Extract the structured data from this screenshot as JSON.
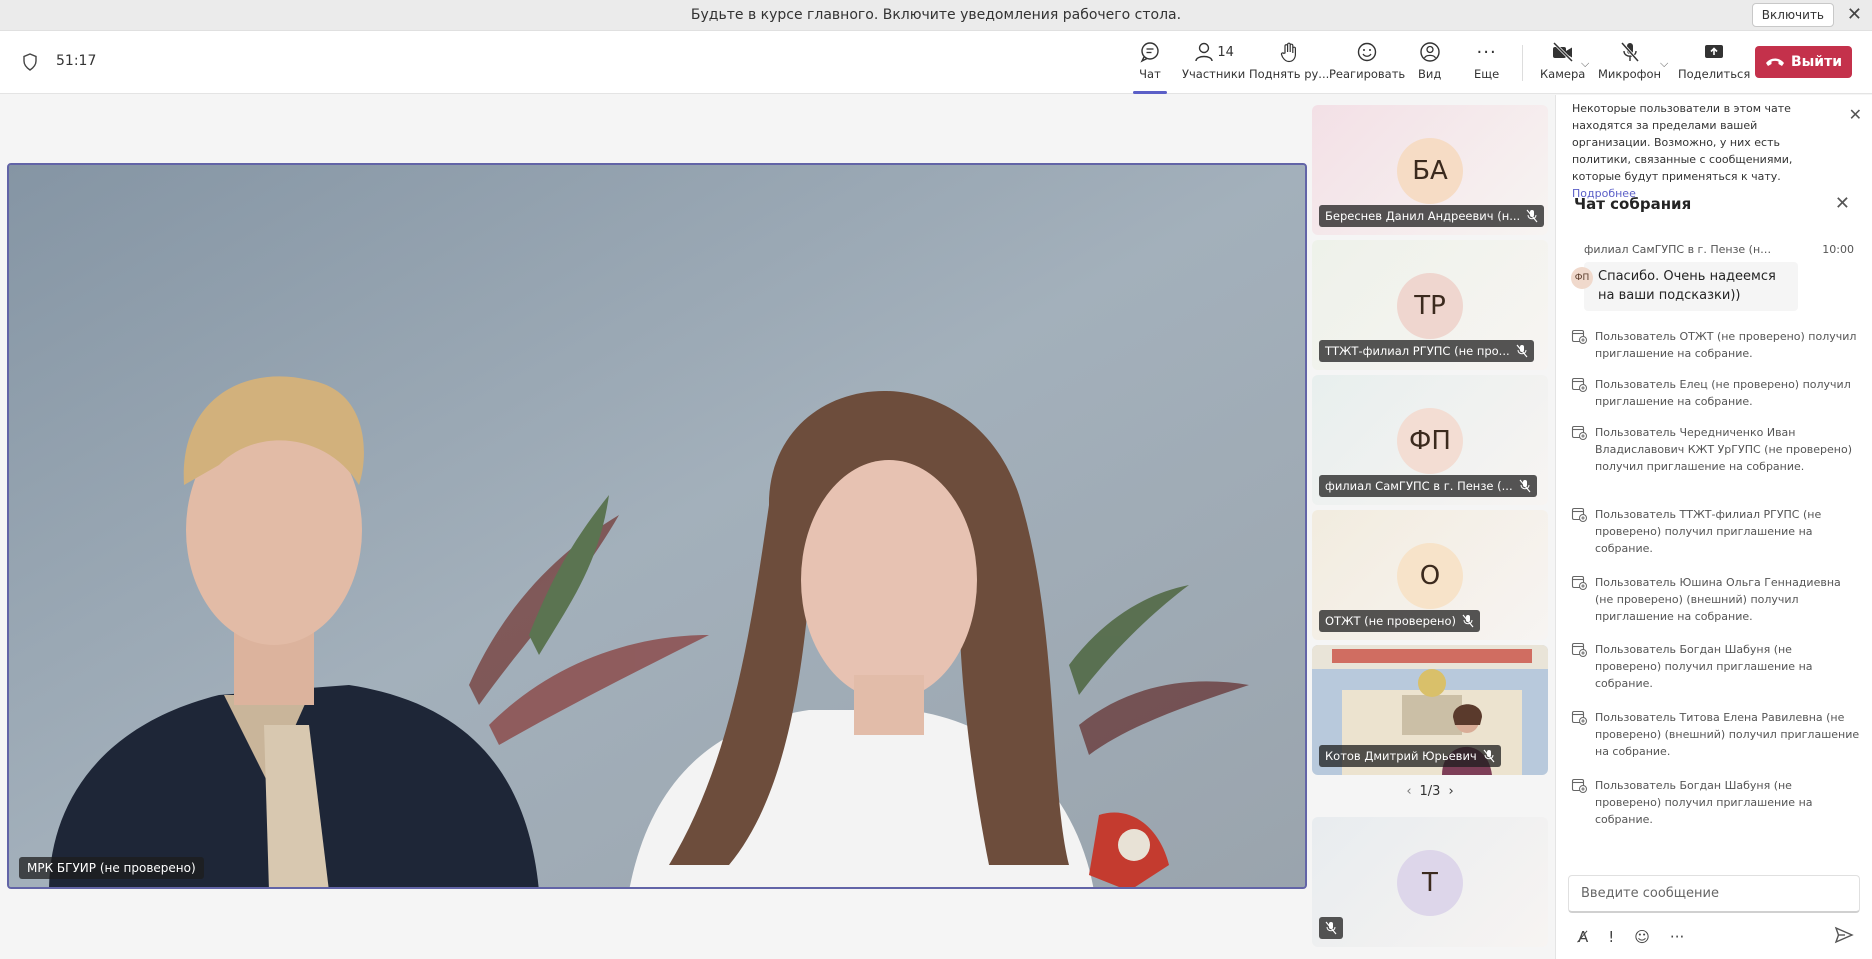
{
  "notification": {
    "text": "Будьте в курсе главного. Включите уведомления рабочего стола.",
    "enable_label": "Включить"
  },
  "toolbar": {
    "timer": "51:17",
    "chat_label": "Чат",
    "participants_label": "Участники",
    "participants_count": "14",
    "raise_hand_label": "Поднять ру...",
    "react_label": "Реагировать",
    "view_label": "Вид",
    "more_label": "Еще",
    "camera_label": "Камера",
    "mic_label": "Микрофон",
    "share_label": "Поделиться",
    "leave_label": "Выйти"
  },
  "stage": {
    "name": "МРК БГУИР (не проверено)"
  },
  "tiles": [
    {
      "initials": "БА",
      "name": "Береснев Данил Андреевич (н...",
      "bg": "#f3e0e6",
      "avatar": "#f6dcc5"
    },
    {
      "initials": "ТР",
      "name": "ТТЖТ-филиал РГУПС (не про...",
      "bg": "#eef2ea",
      "avatar": "#efd6cf"
    },
    {
      "initials": "ФП",
      "name": "филиал СамГУПС в г. Пензе (...",
      "bg": "#e8efee",
      "avatar": "#f3ddd3"
    },
    {
      "initials": "О",
      "name": "ОТЖТ (не проверено)",
      "bg": "#f2ecdf",
      "avatar": "#f7e3c9"
    },
    {
      "initials": "",
      "name": "Котов Дмитрий Юрьевич",
      "bg": "#b9c6d6",
      "avatar": ""
    },
    {
      "initials": "Т",
      "name": "",
      "bg": "#e8ecef",
      "avatar": "#ddd6ea"
    }
  ],
  "pager": {
    "text": "1/3"
  },
  "panel": {
    "info_text": "Некоторые пользователи в этом чате находятся за пределами вашей организации. Возможно, у них есть политики, связанные с сообщениями, которые будут применяться к чату.",
    "info_link": "Подробнее",
    "chat_title": "Чат собрания",
    "message": {
      "sender": "филиал СамГУПС в г. Пензе (не прове...",
      "time": "10:00",
      "avatar": "ФП",
      "text": "Спасибо. Очень надеемся на ваши подсказки))"
    },
    "system_messages": [
      "Пользователь ОТЖТ (не проверено) получил приглашение на собрание.",
      "Пользователь Елец (не проверено) получил приглашение на собрание.",
      "Пользователь Чередниченко Иван Владиславович КЖТ УрГУПС (не проверено) получил приглашение на собрание.",
      "Пользователь ТТЖТ-филиал РГУПС (не проверено) получил приглашение на собрание.",
      "Пользователь Юшина Ольга Геннадиевна (не проверено) (внешний) получил приглашение на собрание.",
      "Пользователь Богдан Шабуня (не проверено) получил приглашение на собрание.",
      "Пользователь Титова Елена Равилевна (не проверено) (внешний) получил приглашение на собрание.",
      "Пользователь Богдан Шабуня (не проверено) получил приглашение на собрание."
    ],
    "compose_placeholder": "Введите сообщение"
  },
  "colors": {
    "accent": "#5b5fc7",
    "leave": "#c4314b"
  }
}
